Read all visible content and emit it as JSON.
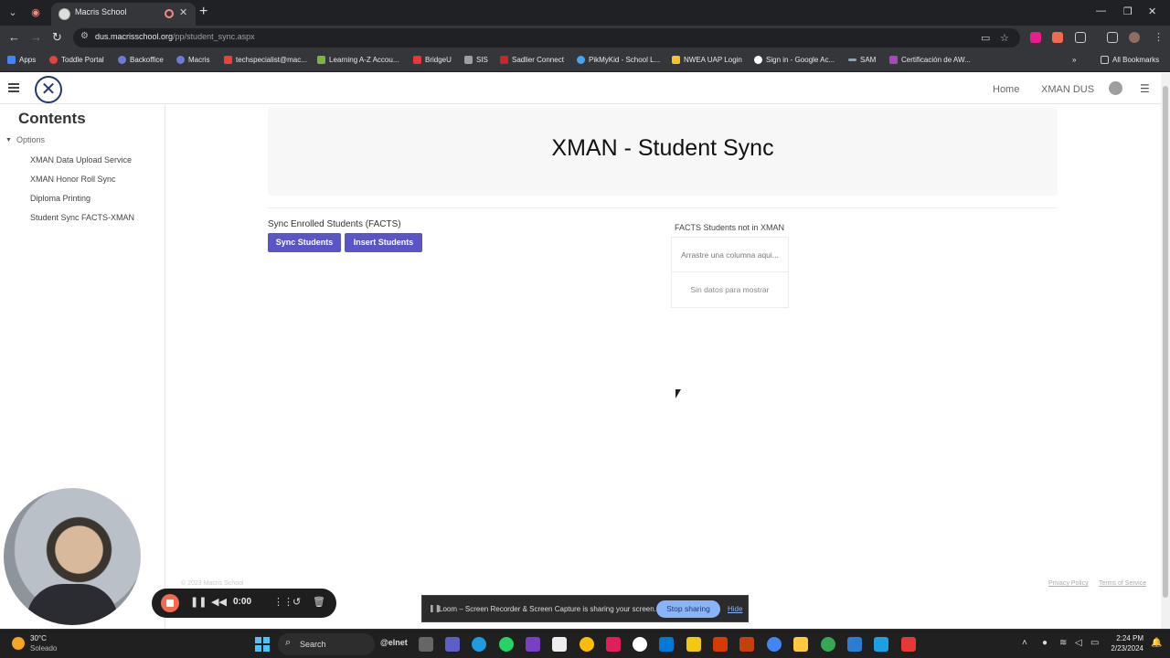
{
  "browser": {
    "tab_title": "Macris School",
    "url_host": "dus.macrisschool.org",
    "url_path": "/pp/student_sync.aspx",
    "bookmarks": [
      {
        "label": "Apps",
        "color": "#4285f4"
      },
      {
        "label": "Toddle Portal",
        "color": "#e0443a"
      },
      {
        "label": "Backoffice",
        "color": "#6b7bd9"
      },
      {
        "label": "Macris",
        "color": "#6b7bd9"
      },
      {
        "label": "techspecialist@mac...",
        "color": "#ea4335"
      },
      {
        "label": "Learning A-Z Accou...",
        "color": "#7cb342"
      },
      {
        "label": "BridgeU",
        "color": "#e53935"
      },
      {
        "label": "SIS",
        "color": "#9e9e9e"
      },
      {
        "label": "Sadlier Connect",
        "color": "#c62828"
      },
      {
        "label": "PikMyKid - School L...",
        "color": "#42a5f5"
      },
      {
        "label": "NWEA UAP Login",
        "color": "#fbc02d"
      },
      {
        "label": "Sign in - Google Ac...",
        "color": "#ffffff"
      },
      {
        "label": "SAM",
        "color": "#90a4ae"
      },
      {
        "label": "Certificación de AW...",
        "color": "#ab47bc"
      }
    ],
    "all_bookmarks": "All Bookmarks"
  },
  "header": {
    "nav_home": "Home",
    "nav_user": "XMAN DUS"
  },
  "sidebar": {
    "title": "Contents",
    "group": "Options",
    "items": [
      {
        "label": "XMAN Data Upload Service"
      },
      {
        "label": "XMAN Honor Roll Sync"
      },
      {
        "label": "Diploma Printing"
      },
      {
        "label": "Student Sync FACTS-XMAN"
      }
    ]
  },
  "main": {
    "page_title": "XMAN - Student Sync",
    "sync_label": "Sync Enrolled Students (FACTS)",
    "sync_button": "Sync Students",
    "insert_button": "Insert Students",
    "grid_title": "FACTS Students not in XMAN",
    "grid_group_panel": "Arrastre una columna aqui...",
    "grid_empty": "Sin datos para mostrar",
    "accent_color": "#5a55c6"
  },
  "footer": {
    "copyright": "© 2023 Macris School",
    "privacy": "Privacy Policy",
    "terms": "Terms of Service"
  },
  "loom": {
    "timer": "0:00",
    "share_message": "Loom – Screen Recorder & Screen Capture is sharing your screen.",
    "stop_sharing": "Stop sharing",
    "hide": "Hide"
  },
  "taskbar": {
    "weather_temp": "30°C",
    "weather_desc": "Soleado",
    "search_placeholder": "Search",
    "time": "2:24 PM",
    "date": "2/23/2024"
  }
}
